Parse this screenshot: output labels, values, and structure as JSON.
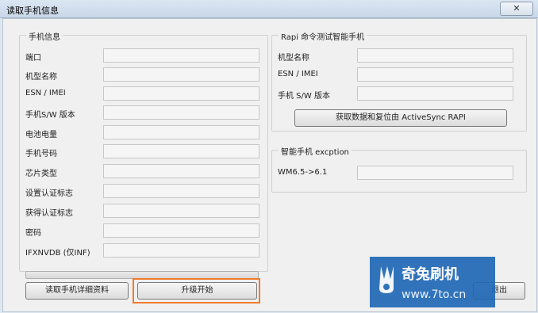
{
  "window": {
    "title": "读取手机信息",
    "close": "✕"
  },
  "left": {
    "group_title": "手机信息",
    "items": [
      {
        "label": "端口",
        "value": ""
      },
      {
        "label": "机型名称",
        "value": ""
      },
      {
        "label": "ESN / IMEI",
        "value": ""
      },
      {
        "label": "手机S/W 版本",
        "value": ""
      },
      {
        "label": "电池电量",
        "value": ""
      },
      {
        "label": "手机号码",
        "value": ""
      },
      {
        "label": "芯片类型",
        "value": ""
      },
      {
        "label": "设置认证标志",
        "value": ""
      },
      {
        "label": "获得认证标志",
        "value": ""
      },
      {
        "label": "密码",
        "value": ""
      },
      {
        "label": "IFXNVDB (仅INF)",
        "value": ""
      }
    ],
    "buttons": {
      "read_details": "读取手机详细资料",
      "start_upgrade": "升级开始"
    }
  },
  "rapi": {
    "group_title": "Rapi 命令测试智能手机",
    "items": [
      {
        "label": "机型名称",
        "value": ""
      },
      {
        "label": "ESN / IMEI",
        "value": ""
      },
      {
        "label": "手机 S/W 版本",
        "value": ""
      }
    ],
    "button": "获取数据和复位由 ActiveSync RAPI"
  },
  "exception": {
    "group_title": "智能手机 excption",
    "items": [
      {
        "label": "WM6.5->6.1",
        "value": ""
      }
    ]
  },
  "bottom": {
    "exit": "退出"
  },
  "watermark": {
    "title": "奇兔刷机",
    "url": "www.7to.cn"
  },
  "colors": {
    "highlight": "#f07a2a",
    "watermark_bg": "#1d66b5"
  }
}
